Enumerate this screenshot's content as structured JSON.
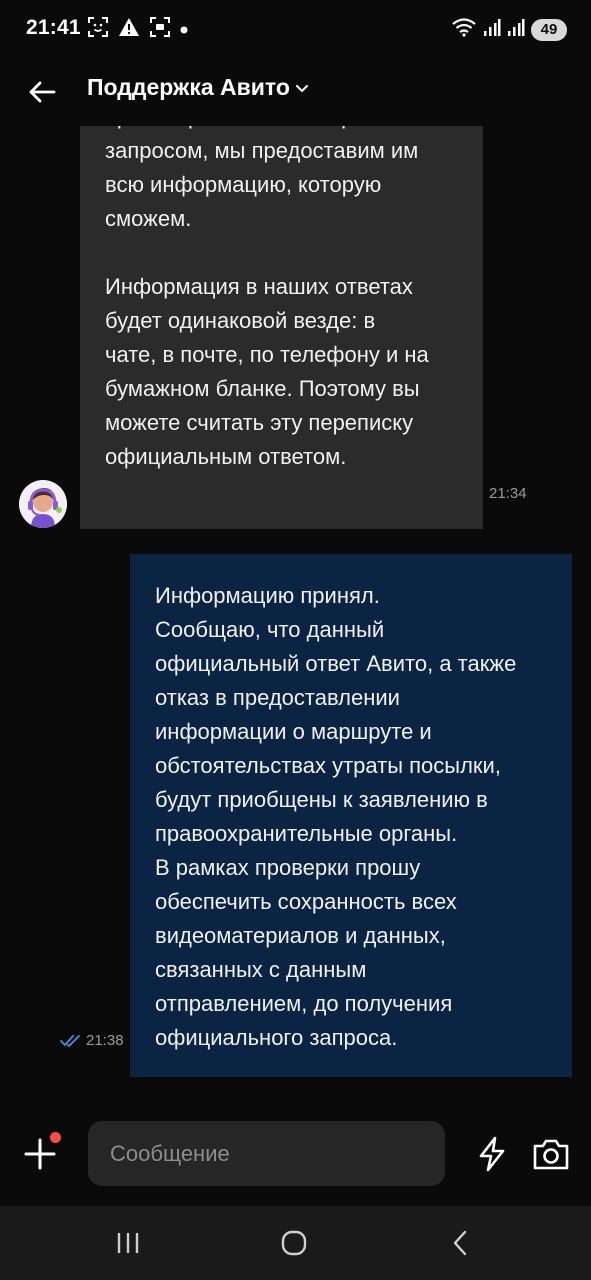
{
  "status_bar": {
    "time": "21:41",
    "battery": "49",
    "icons_left": [
      "face-scan-icon",
      "warning-icon",
      "scan-icon",
      "dot-icon"
    ],
    "icons_right": [
      "wifi-icon",
      "signal-icon",
      "signal-icon",
      "battery-icon"
    ]
  },
  "header": {
    "title": "Поддержка Авито",
    "back_icon": "arrow-left-icon",
    "dropdown_icon": "chevron-down-icon"
  },
  "messages": [
    {
      "direction": "incoming",
      "text": "правоохранительные органы с\nзапросом, мы предоставим им\nвсю информацию, которую\nсможем.\n\nИнформация в наших ответах\nбудет одинаковой везде: в\nчате, в почте, по телефону и на\nбумажном бланке. Поэтому вы\nможете считать эту переписку\nофициальным ответом.",
      "time": "21:34"
    },
    {
      "direction": "outgoing",
      "text": "Информацию принял.\nСообщаю, что данный\nофициальный ответ Авито, а также\nотказ в предоставлении\nинформации о маршруте и\nобстоятельствах утраты посылки,\nбудут приобщены к заявлению в\nправоохранительные органы.\nВ рамках проверки прошу\nобеспечить сохранность всех\nвидеоматериалов и данных,\nсвязанных с данным\nотправлением, до получения\nофициального запроса.",
      "time": "21:38",
      "status_icon": "double-check-icon"
    }
  ],
  "composer": {
    "placeholder": "Сообщение",
    "value": "",
    "icons": [
      "plus-icon",
      "bolt-icon",
      "camera-icon"
    ]
  },
  "nav_bar": {
    "icons": [
      "recent-apps-icon",
      "home-icon",
      "back-icon"
    ]
  },
  "colors": {
    "background": "#0a0a0a",
    "incoming_bubble": "#2b2b2b",
    "outgoing_bubble": "#0b2444",
    "read_check": "#4a90e2",
    "notification_dot": "#ff4a4a"
  }
}
